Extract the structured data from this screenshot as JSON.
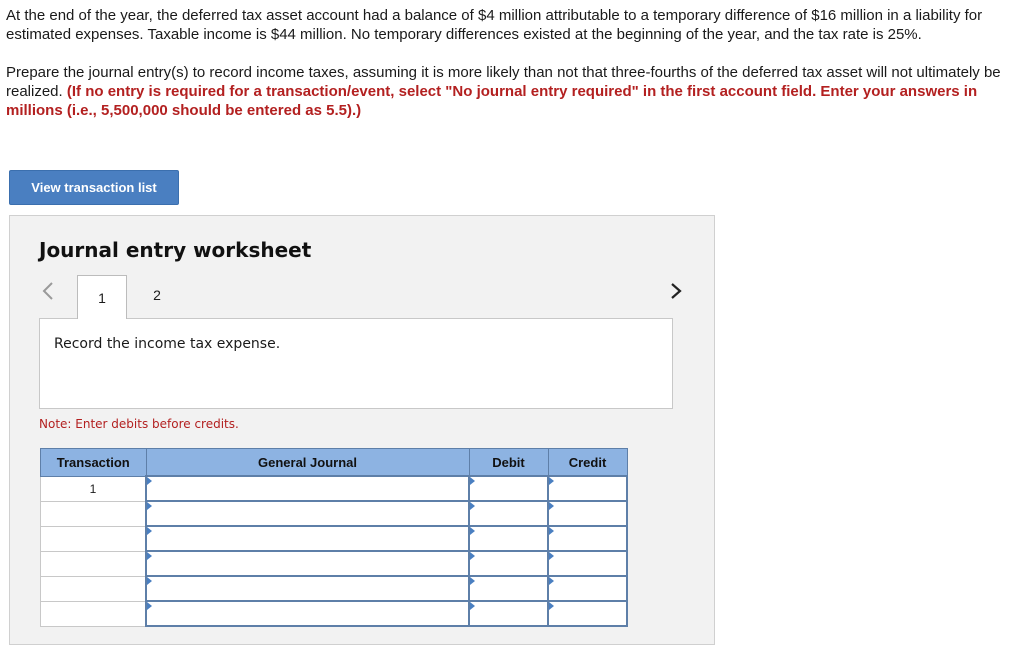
{
  "problem": {
    "paragraph1": "At the end of the year, the deferred tax asset account had a balance of $4 million attributable to a temporary difference of $16 million in a liability for estimated expenses. Taxable income is $44 million. No temporary differences existed at the beginning of the year, and the tax rate is 25%.",
    "paragraph2": "Prepare the journal entry(s) to record income taxes, assuming it is more likely than not that three-fourths of the deferred tax asset will not ultimately be realized.",
    "instruction": "(If no entry is required for a transaction/event, select \"No journal entry required\" in the first account field. Enter your answers in millions (i.e., 5,500,000 should be entered as 5.5).)"
  },
  "view_transaction_button": "View transaction list",
  "worksheet": {
    "title": "Journal entry worksheet",
    "tabs": [
      "1",
      "2"
    ],
    "active_tab": "1",
    "description": "Record the income tax expense.",
    "note": "Note: Enter debits before credits.",
    "columns": [
      "Transaction",
      "General Journal",
      "Debit",
      "Credit"
    ],
    "rows": [
      {
        "transaction": "1",
        "account": "",
        "debit": "",
        "credit": ""
      },
      {
        "transaction": "",
        "account": "",
        "debit": "",
        "credit": ""
      },
      {
        "transaction": "",
        "account": "",
        "debit": "",
        "credit": ""
      },
      {
        "transaction": "",
        "account": "",
        "debit": "",
        "credit": ""
      },
      {
        "transaction": "",
        "account": "",
        "debit": "",
        "credit": ""
      },
      {
        "transaction": "",
        "account": "",
        "debit": "",
        "credit": ""
      }
    ]
  },
  "colors": {
    "accent": "#4a7fc1",
    "header_bg": "#8db3e2",
    "instruction_red": "#b32020"
  }
}
